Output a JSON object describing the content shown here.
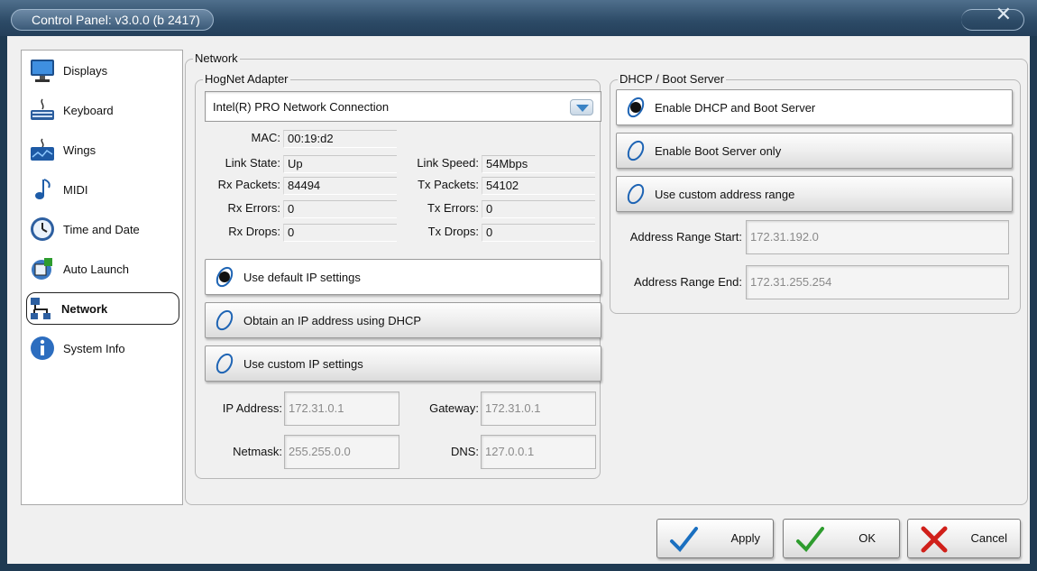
{
  "window": {
    "title": "Control Panel: v3.0.0 (b 2417)",
    "close_icon": "close-icon"
  },
  "sidebar": {
    "items": [
      {
        "label": "Displays",
        "icon": "monitor-icon"
      },
      {
        "label": "Keyboard",
        "icon": "keyboard-icon"
      },
      {
        "label": "Wings",
        "icon": "wing-icon"
      },
      {
        "label": "MIDI",
        "icon": "music-note-icon"
      },
      {
        "label": "Time and Date",
        "icon": "clock-icon"
      },
      {
        "label": "Auto Launch",
        "icon": "auto-launch-icon"
      },
      {
        "label": "Network",
        "icon": "network-icon",
        "selected": true
      },
      {
        "label": "System Info",
        "icon": "info-icon"
      }
    ]
  },
  "network": {
    "group_label": "Network",
    "adapter": {
      "group_label": "HogNet Adapter",
      "selected": "Intel(R) PRO  Network Connection",
      "mac_label": "MAC:",
      "mac": "00:19:d2",
      "link_state_label": "Link State:",
      "link_state": "Up",
      "link_speed_label": "Link Speed:",
      "link_speed": "54Mbps",
      "rx_packets_label": "Rx Packets:",
      "rx_packets": "84494",
      "tx_packets_label": "Tx Packets:",
      "tx_packets": "54102",
      "rx_errors_label": "Rx Errors:",
      "rx_errors": "0",
      "tx_errors_label": "Tx Errors:",
      "tx_errors": "0",
      "rx_drops_label": "Rx Drops:",
      "rx_drops": "0",
      "tx_drops_label": "Tx Drops:",
      "tx_drops": "0",
      "options": [
        {
          "label": "Use default IP settings",
          "selected": true
        },
        {
          "label": "Obtain an IP address using DHCP",
          "selected": false
        },
        {
          "label": "Use custom IP settings",
          "selected": false
        }
      ],
      "ip_label": "IP Address:",
      "ip": "172.31.0.1",
      "gateway_label": "Gateway:",
      "gateway": "172.31.0.1",
      "netmask_label": "Netmask:",
      "netmask": "255.255.0.0",
      "dns_label": "DNS:",
      "dns": "127.0.0.1"
    },
    "dhcp": {
      "group_label": "DHCP / Boot Server",
      "options": [
        {
          "label": "Enable DHCP and Boot Server",
          "selected": true
        },
        {
          "label": "Enable Boot Server only",
          "selected": false
        },
        {
          "label": "Use custom address range",
          "selected": false
        }
      ],
      "range_start_label": "Address Range Start:",
      "range_start": "172.31.192.0",
      "range_end_label": "Address Range End:",
      "range_end": "172.31.255.254"
    }
  },
  "buttons": {
    "apply": "Apply",
    "ok": "OK",
    "cancel": "Cancel"
  },
  "colors": {
    "title_bar": "#2c4a66",
    "check_blue": "#1a6fc0",
    "check_green": "#2e9c2e",
    "cancel_red": "#d0201a",
    "radio_blue": "#1e64b4"
  }
}
